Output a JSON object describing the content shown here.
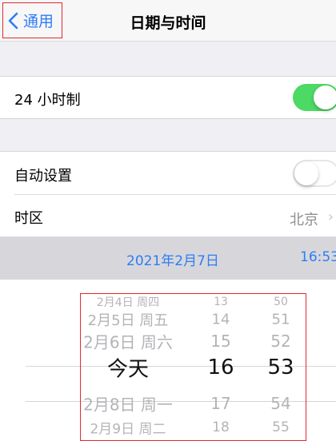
{
  "nav": {
    "back_label": "通用",
    "title": "日期与时间"
  },
  "hour24": {
    "label": "24 小时制",
    "enabled": true
  },
  "auto_set": {
    "label": "自动设置",
    "enabled": false
  },
  "timezone": {
    "label": "时区",
    "value": "北京",
    "chevron": "›"
  },
  "current": {
    "date": "2021年2月7日",
    "time": "16:53"
  },
  "picker": {
    "rows": [
      {
        "date": "2月4日 周四",
        "hour": "13",
        "minute": "50"
      },
      {
        "date": "2月5日 周五",
        "hour": "14",
        "minute": "51"
      },
      {
        "date": "2月6日 周六",
        "hour": "15",
        "minute": "52"
      },
      {
        "date": "今天",
        "hour": "16",
        "minute": "53"
      },
      {
        "date": "2月8日 周一",
        "hour": "17",
        "minute": "54"
      },
      {
        "date": "2月9日 周二",
        "hour": "18",
        "minute": "55"
      }
    ],
    "selected_index": 3
  },
  "colors": {
    "accent": "#2f7cf6",
    "switch_on": "#4cd964",
    "highlight_box": "#e0292f"
  }
}
